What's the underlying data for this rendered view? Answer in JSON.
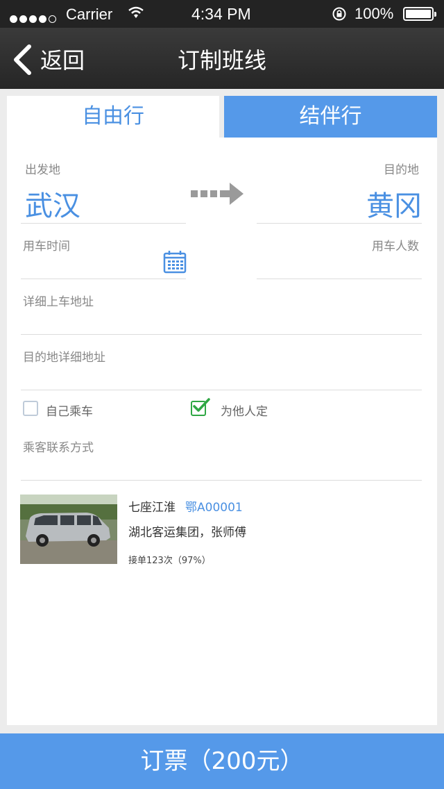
{
  "status_bar": {
    "carrier": "Carrier",
    "time": "4:34 PM",
    "battery": "100%",
    "signal_strength": 4
  },
  "nav": {
    "back_label": "返回",
    "title": "订制班线"
  },
  "tabs": [
    {
      "label": "自由行",
      "selected": false
    },
    {
      "label": "结伴行",
      "selected": true
    }
  ],
  "route": {
    "origin_label": "出发地",
    "origin_city": "武汉",
    "destination_label": "目的地",
    "destination_city": "黄冈"
  },
  "fields": {
    "time_label": "用车时间",
    "count_label": "用车人数",
    "pickup_address_label": "详细上车地址",
    "dest_address_label": "目的地详细地址",
    "contact_label": "乘客联系方式"
  },
  "options": {
    "self_ride_label": "自己乘车",
    "self_ride_checked": false,
    "for_others_label": "为他人定",
    "for_others_checked": true
  },
  "vehicle": {
    "model": "七座江淮",
    "plate": "鄂A00001",
    "company": "湖北客运集团，张师傅",
    "orders": "接单123次（97%）"
  },
  "order_button": {
    "label": "订票（200元）"
  },
  "colors": {
    "accent": "#4a90e2",
    "tab_active_bg": "#5599e9",
    "checkbox_checked": "#2fa744",
    "nav_bg": "#2d2d2d"
  }
}
